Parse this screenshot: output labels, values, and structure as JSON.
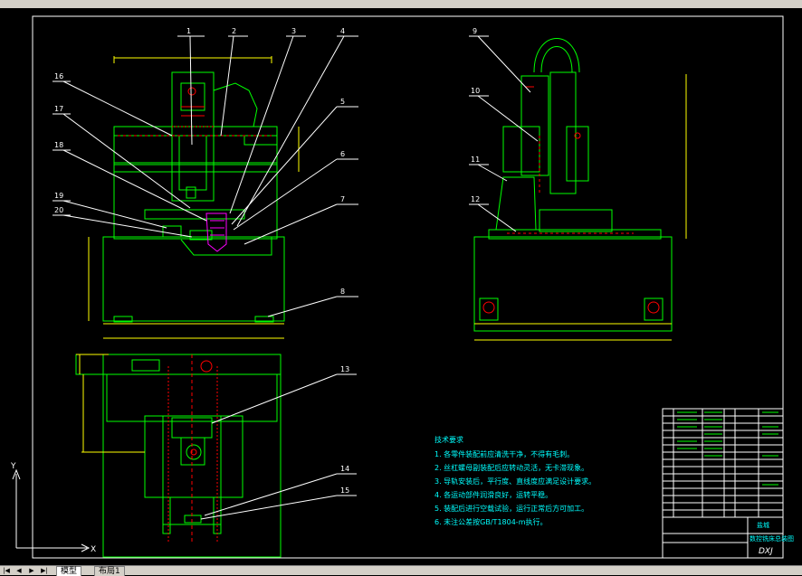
{
  "tabs": {
    "model": "模型",
    "layout": "布局1"
  },
  "balloons": [
    "1",
    "2",
    "3",
    "4",
    "5",
    "6",
    "7",
    "8",
    "9",
    "10",
    "11",
    "12",
    "13",
    "14",
    "15",
    "16",
    "17",
    "18",
    "19",
    "20"
  ],
  "title_block": {
    "company": "盐城",
    "name": "数控铣床总装图",
    "code": "DXJ"
  },
  "notes": {
    "heading": "技术要求",
    "lines": [
      "1. 各零件装配前应清洗干净，不得有毛刺。",
      "2. 丝杠螺母副装配后应转动灵活，无卡滞现象。",
      "3. 导轨安装后，平行度、直线度应满足设计要求。",
      "4. 各运动部件润滑良好，运转平稳。",
      "5. 装配后进行空载试验，运行正常后方可加工。",
      "6. 未注公差按GB/T1804-m执行。"
    ]
  },
  "colors": {
    "frame": "#ffffff",
    "part": "#00ff00",
    "leader": "#ffffff",
    "dim": "#ffff00",
    "red": "#ff0000",
    "magenta": "#ff00ff",
    "cyan": "#00ffff",
    "note": "#00ffff"
  }
}
